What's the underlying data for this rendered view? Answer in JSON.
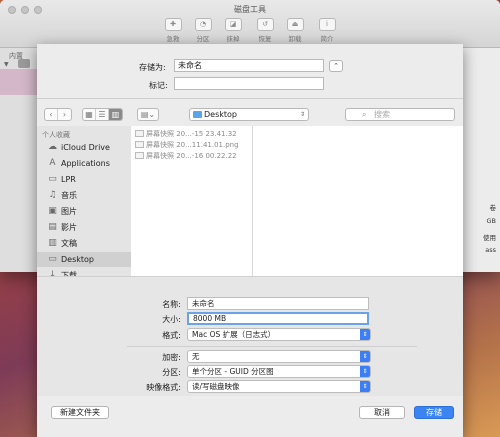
{
  "window": {
    "title": "磁盘工具",
    "toolbar": [
      "急救",
      "分区",
      "抹掉",
      "恢复",
      "卸载",
      "简介"
    ],
    "sidebar_header": "内置",
    "right_fragments": [
      "卷",
      "GB",
      "使用",
      "ass"
    ]
  },
  "save": {
    "save_as_label": "存储为:",
    "save_as_value": "未命名",
    "tags_label": "标记:",
    "tags_value": ""
  },
  "nav": {
    "back": "‹",
    "forward": "›",
    "location": "Desktop",
    "search_placeholder": "搜索"
  },
  "sidebar": {
    "header": "个人收藏",
    "items": [
      {
        "label": "iCloud Drive",
        "icon": "☁"
      },
      {
        "label": "Applications",
        "icon": "A"
      },
      {
        "label": "LPR",
        "icon": "▭"
      },
      {
        "label": "音乐",
        "icon": "♫"
      },
      {
        "label": "图片",
        "icon": "▣"
      },
      {
        "label": "影片",
        "icon": "▤"
      },
      {
        "label": "文稿",
        "icon": "▥"
      },
      {
        "label": "Desktop",
        "icon": "▭"
      },
      {
        "label": "下载",
        "icon": "↓"
      }
    ]
  },
  "files": [
    "屏幕快照 20...-15 23.41.32",
    "屏幕快照 20...11.41.01.png",
    "屏幕快照 20...-16 00.22.22"
  ],
  "options": {
    "name_label": "名称:",
    "name_value": "未命名",
    "size_label": "大小:",
    "size_value": "8000 MB",
    "format_label": "格式:",
    "format_value": "Mac OS 扩展（日志式）",
    "encryption_label": "加密:",
    "encryption_value": "无",
    "partition_label": "分区:",
    "partition_value": "单个分区 - GUID 分区图",
    "image_format_label": "映像格式:",
    "image_format_value": "读/写磁盘映像"
  },
  "buttons": {
    "new_folder": "新建文件夹",
    "cancel": "取消",
    "save": "存储"
  }
}
